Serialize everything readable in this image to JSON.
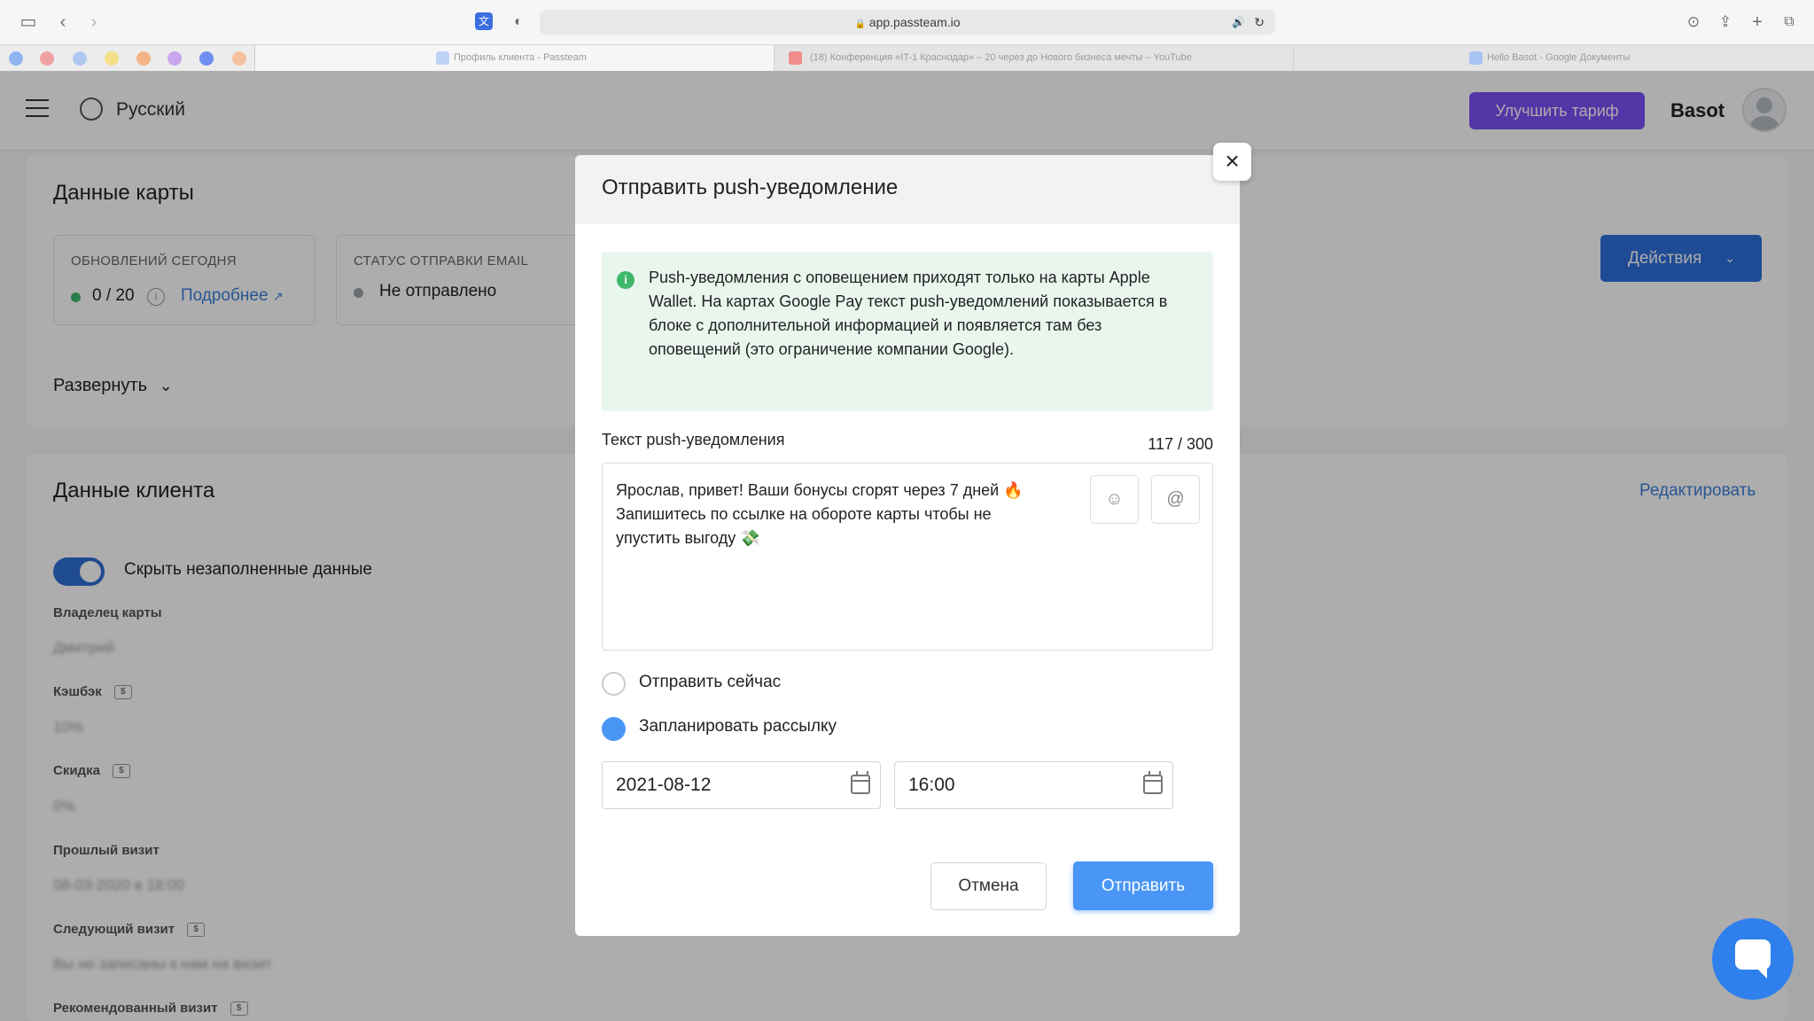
{
  "browser": {
    "url": "app.passteam.io",
    "tabs": [
      {
        "label": "Профиль клиента - Passteam"
      },
      {
        "label": "(18) Конференция «IT-1 Краснодар» – 20 через до Нового бизнеса мечты – YouTube"
      },
      {
        "label": "Hello Basot - Google Документы"
      }
    ]
  },
  "app_header": {
    "language": "Русский",
    "upgrade_label": "Улучшить тариф",
    "user_name": "Basot"
  },
  "card_data": {
    "title": "Данные карты",
    "updates_label": "ОБНОВЛЕНИЙ СЕГОДНЯ",
    "updates_value": "0 / 20",
    "more_link": "Подробнее",
    "email_status_label": "СТАТУС ОТПРАВКИ EMAIL",
    "email_status_value": "Не отправлено",
    "actions_label": "Действия",
    "expand_label": "Развернуть"
  },
  "client_data": {
    "title": "Данные клиента",
    "edit_label": "Редактировать",
    "hide_empty_label": "Скрыть незаполненные данные",
    "fields": [
      {
        "label": "Владелец карты",
        "value": "Дмитрий"
      },
      {
        "label": "Кэшбэк",
        "value": "10%"
      },
      {
        "label": "Скидка",
        "value": "0%"
      },
      {
        "label": "Прошлый визит",
        "value": "08-03-2020 в 18:00"
      },
      {
        "label": "Следующий визит",
        "value": "Вы не записаны к нам на визит"
      },
      {
        "label": "Рекомендованный визит",
        "value": ""
      }
    ]
  },
  "modal": {
    "title": "Отправить push-уведомление",
    "notice": "Push-уведомления с оповещением приходят только на карты Apple Wallet. На картах Google Pay текст push-уведомлений показывается в блоке с дополнительной информацией и появляется там без оповещений (это ограничение компании Google).",
    "text_label": "Текст push-уведомления",
    "char_count": "117 / 300",
    "message": "Ярослав, привет! Ваши бонусы сгорят через 7 дней 🔥 Запишитесь по ссылке на обороте карты чтобы не упустить выгоду 💸",
    "send_now_label": "Отправить сейчас",
    "schedule_label": "Запланировать рассылку",
    "selected_option": "schedule",
    "date_value": "2021-08-12",
    "time_value": "16:00",
    "cancel_label": "Отмена",
    "send_label": "Отправить"
  },
  "colors": {
    "accent": "#4a96f6",
    "upgrade": "#7b4ff5",
    "notice_bg": "#e9f6ee",
    "info": "#3fb86a"
  }
}
